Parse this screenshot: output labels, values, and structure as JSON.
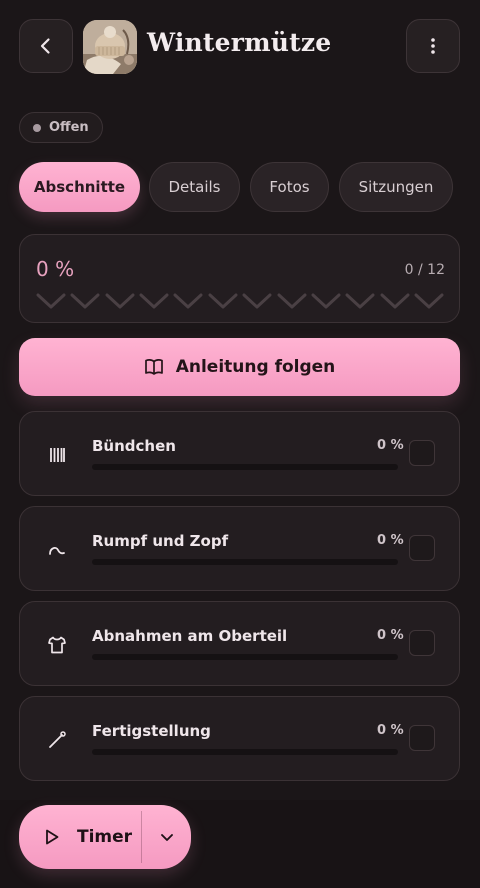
{
  "header": {
    "title": "Wintermütze",
    "back_icon": "chevron-left-icon",
    "menu_icon": "more-vertical-icon",
    "thumbnail": "knit-hat-photo"
  },
  "status": {
    "label": "Offen",
    "color": "#a79aa0"
  },
  "tabs": [
    {
      "label": "Abschnitte",
      "active": true
    },
    {
      "label": "Details",
      "active": false
    },
    {
      "label": "Fotos",
      "active": false
    },
    {
      "label": "Sitzungen",
      "active": false
    }
  ],
  "progress": {
    "percent_label": "0 %",
    "count_label": "0 / 12",
    "completed": 0,
    "total": 12
  },
  "follow_button": {
    "label": "Anleitung folgen",
    "icon": "book-open-icon"
  },
  "sections": [
    {
      "name": "Bündchen",
      "percent_label": "0 %",
      "progress": 0,
      "icon": "ribbing-icon",
      "checked": false
    },
    {
      "name": "Rumpf und Zopf",
      "percent_label": "0 %",
      "progress": 0,
      "icon": "cable-icon",
      "checked": false
    },
    {
      "name": "Abnahmen am Oberteil",
      "percent_label": "0 %",
      "progress": 0,
      "icon": "shirt-icon",
      "checked": false
    },
    {
      "name": "Fertigstellung",
      "percent_label": "0 %",
      "progress": 0,
      "icon": "needle-icon",
      "checked": false
    }
  ],
  "timer": {
    "label": "Timer",
    "play_icon": "play-icon",
    "dropdown_icon": "chevron-down-icon"
  },
  "colors": {
    "accent": "#f7a6c8",
    "background": "#1b1618",
    "card": "#231d20"
  }
}
